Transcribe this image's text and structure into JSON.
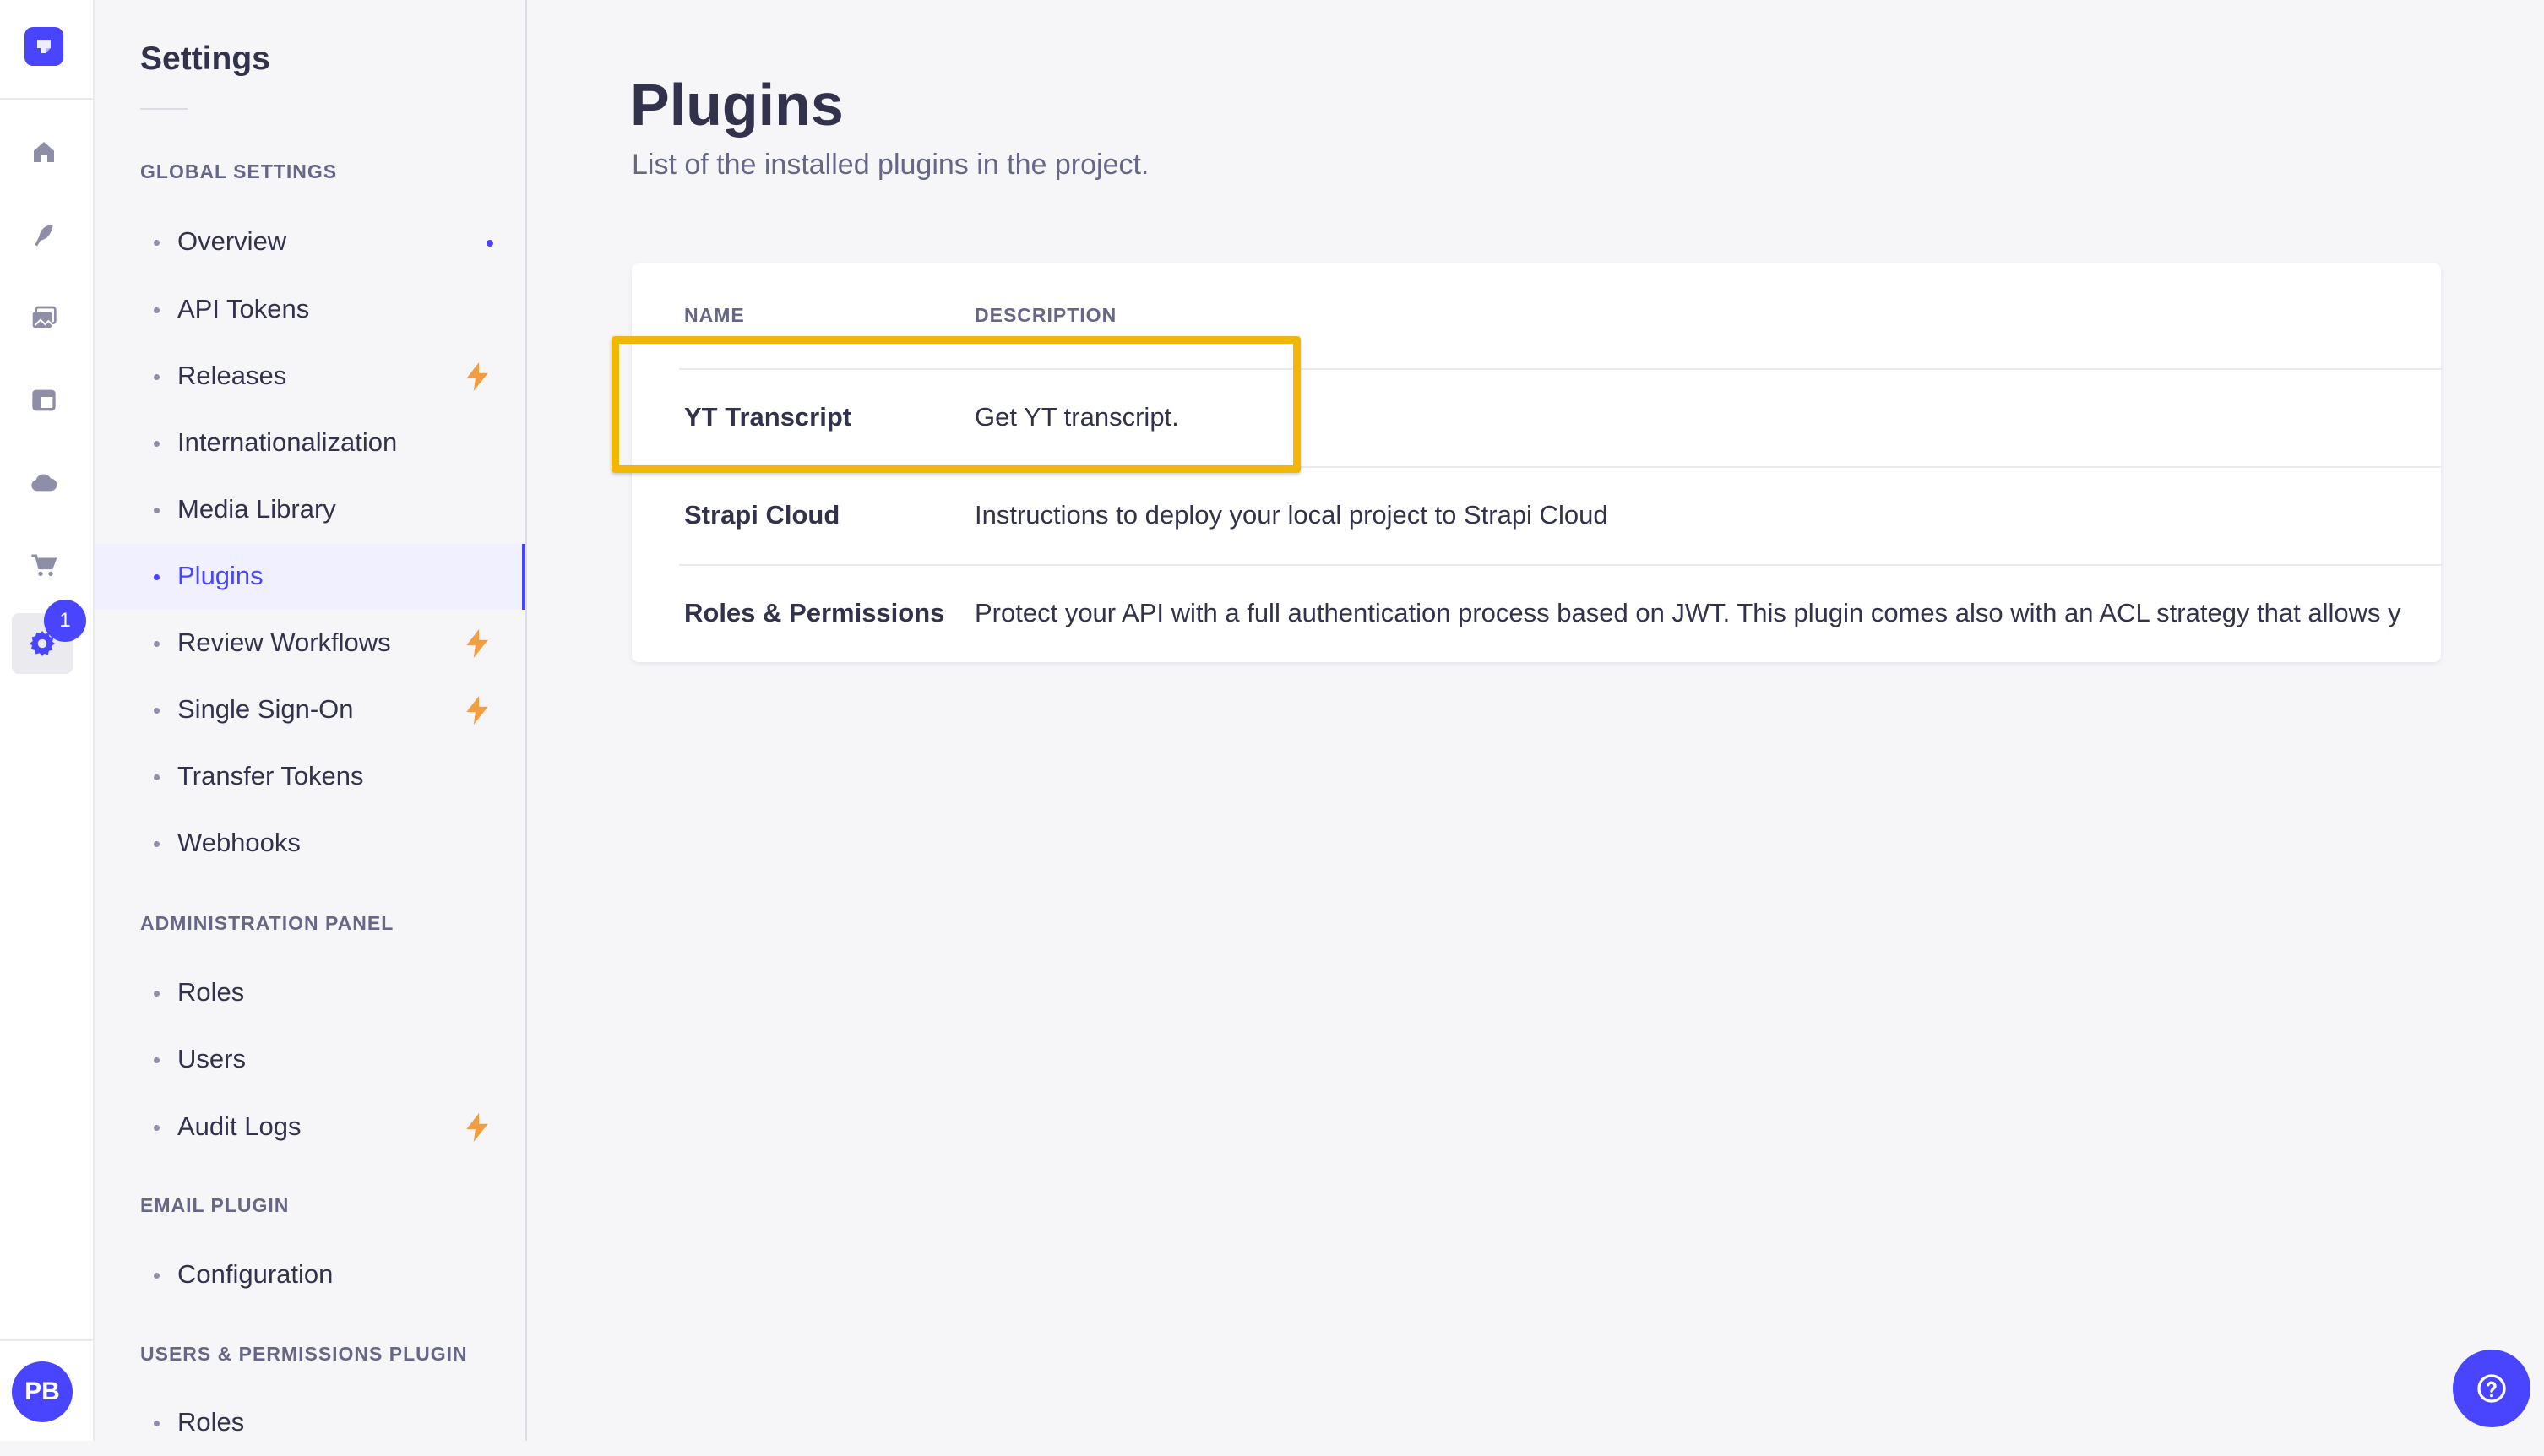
{
  "rail": {
    "icons": [
      "logo-icon",
      "home-icon",
      "content-manager-icon",
      "media-library-icon",
      "content-type-builder-icon",
      "cloud-icon",
      "marketplace-icon",
      "settings-icon"
    ],
    "settings_badge": "1",
    "avatar_initials": "PB"
  },
  "sidebar": {
    "title": "Settings",
    "sections": [
      {
        "title": "GLOBAL SETTINGS",
        "items": [
          {
            "label": "Overview",
            "marker": "dot"
          },
          {
            "label": "API Tokens"
          },
          {
            "label": "Releases",
            "marker": "bolt"
          },
          {
            "label": "Internationalization"
          },
          {
            "label": "Media Library"
          },
          {
            "label": "Plugins",
            "active": true
          },
          {
            "label": "Review Workflows",
            "marker": "bolt"
          },
          {
            "label": "Single Sign-On",
            "marker": "bolt"
          },
          {
            "label": "Transfer Tokens"
          },
          {
            "label": "Webhooks"
          }
        ]
      },
      {
        "title": "ADMINISTRATION PANEL",
        "items": [
          {
            "label": "Roles"
          },
          {
            "label": "Users"
          },
          {
            "label": "Audit Logs",
            "marker": "bolt"
          }
        ]
      },
      {
        "title": "EMAIL PLUGIN",
        "items": [
          {
            "label": "Configuration"
          }
        ]
      },
      {
        "title": "USERS & PERMISSIONS PLUGIN",
        "items": [
          {
            "label": "Roles"
          }
        ]
      }
    ]
  },
  "main": {
    "title": "Plugins",
    "subtitle": "List of the installed plugins in the project.",
    "table": {
      "columns": [
        "NAME",
        "DESCRIPTION"
      ],
      "rows": [
        {
          "name": "YT Transcript",
          "description": "Get YT transcript."
        },
        {
          "name": "Strapi Cloud",
          "description": "Instructions to deploy your local project to Strapi Cloud"
        },
        {
          "name": "Roles & Permissions",
          "description": "Protect your API with a full authentication process based on JWT. This plugin comes also with an ACL strategy that allows y"
        }
      ]
    }
  },
  "colors": {
    "accent": "#4945ff",
    "highlight": "#f2b705",
    "bolt": "#f29d41"
  }
}
